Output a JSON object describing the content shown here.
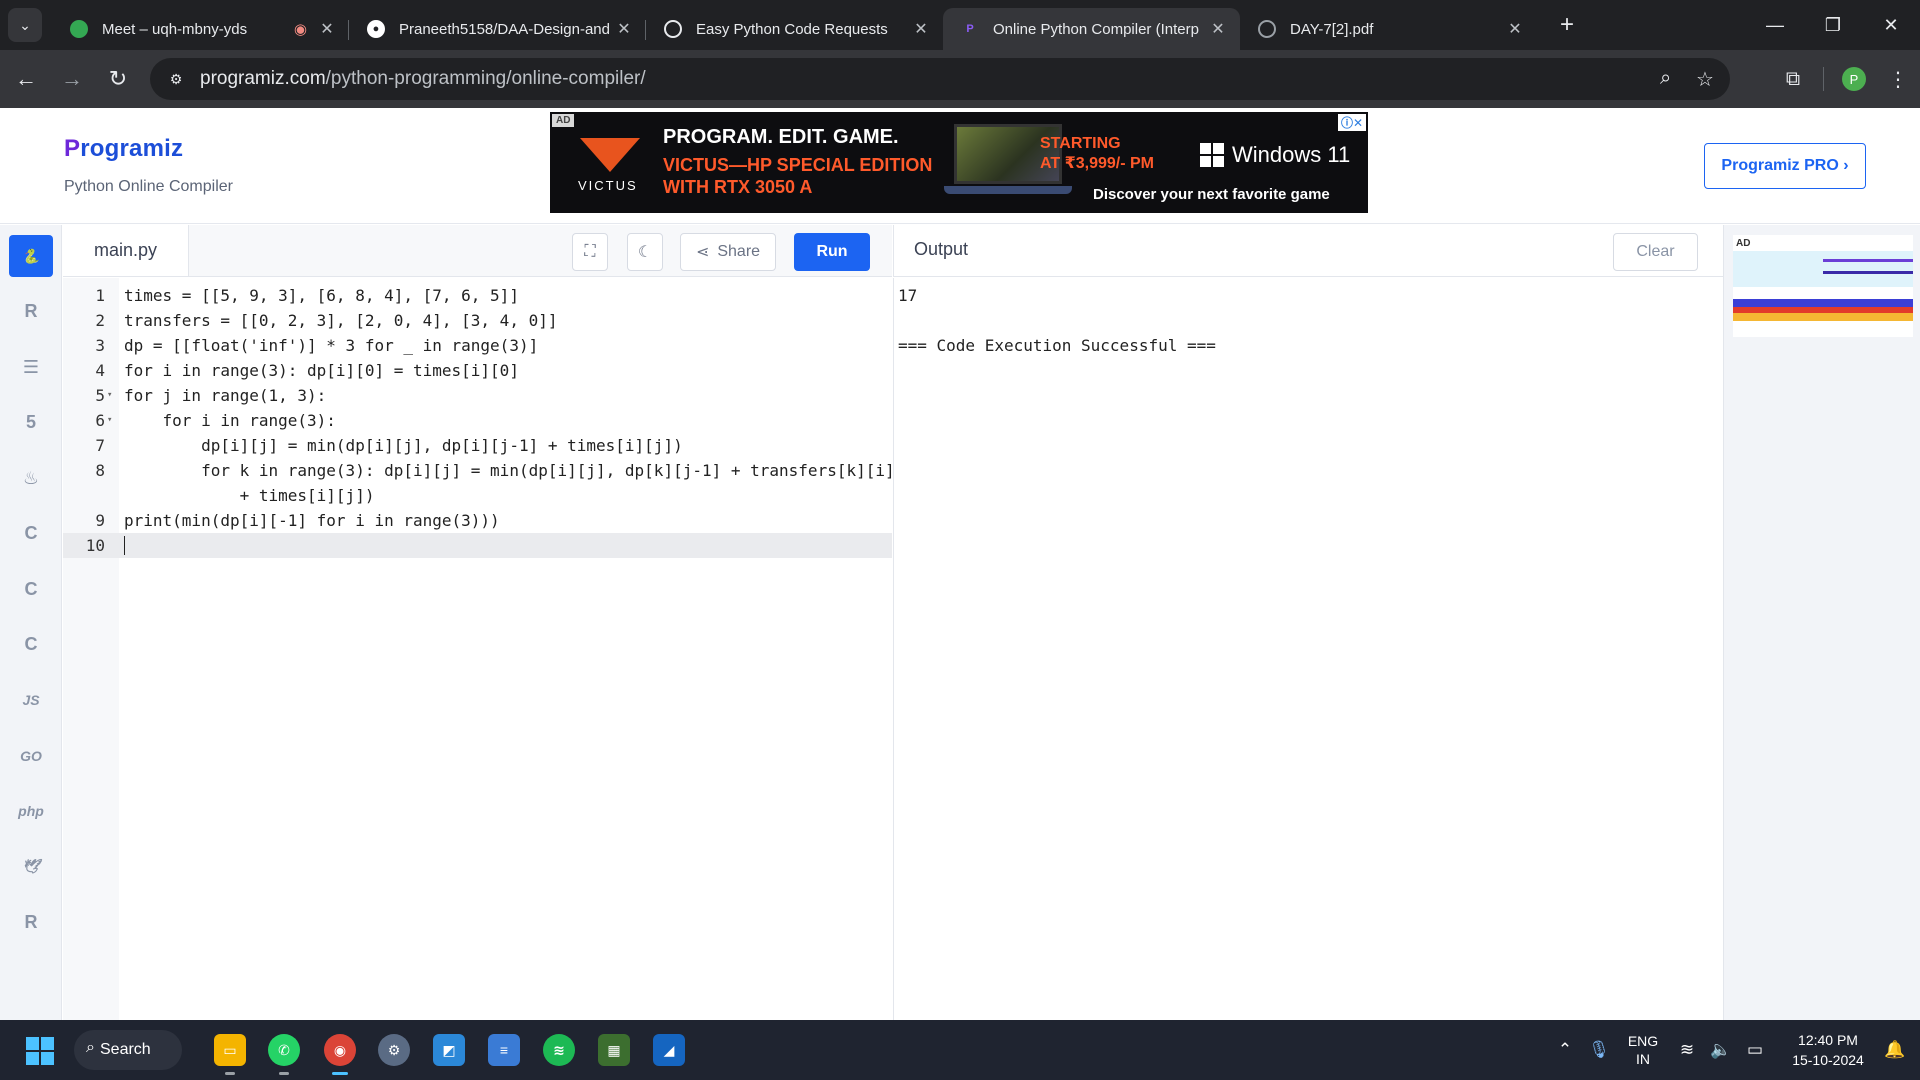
{
  "browser": {
    "tabs": [
      {
        "title": "Meet – uqh-mbny-yds",
        "favicon_color": "#34a853",
        "recording": true
      },
      {
        "title": "Praneeth5158/DAA-Design-and",
        "favicon_color": "#ffffff"
      },
      {
        "title": "Easy Python Code Requests",
        "favicon_color": "#e8eaed"
      },
      {
        "title": "Online Python Compiler (Interp",
        "favicon_color": "#6d28d9",
        "active": true
      },
      {
        "title": "DAY-7[2].pdf",
        "favicon_color": "#9aa0a6"
      }
    ],
    "url_domain": "programiz.com",
    "url_path": "/python-programming/online-compiler/",
    "profile_initial": "P"
  },
  "header": {
    "logo_first": "P",
    "logo_rest": "rogramiz",
    "subtitle": "Python Online Compiler",
    "pro_button": "Programiz PRO ›"
  },
  "ad": {
    "tag": "AD",
    "brand": "VICTUS",
    "headline": "PROGRAM. EDIT. GAME.",
    "subhead_1": "VICTUS—HP SPECIAL EDITION",
    "subhead_2": "WITH RTX 3050 A",
    "price_1": "STARTING",
    "price_2": "AT ₹3,999/- PM",
    "windows": "Windows 11",
    "cta": "Discover your next favorite game"
  },
  "languages": [
    {
      "name": "python-icon",
      "glyph": "🐍",
      "active": true
    },
    {
      "name": "r-icon",
      "glyph": "R"
    },
    {
      "name": "sql-icon",
      "glyph": "☰"
    },
    {
      "name": "html-icon",
      "glyph": "5"
    },
    {
      "name": "java-icon",
      "glyph": "♨"
    },
    {
      "name": "c-icon",
      "glyph": "C"
    },
    {
      "name": "cpp-icon",
      "glyph": "C"
    },
    {
      "name": "csharp-icon",
      "glyph": "C"
    },
    {
      "name": "js-icon",
      "glyph": "JS"
    },
    {
      "name": "go-icon",
      "glyph": "GO"
    },
    {
      "name": "php-icon",
      "glyph": "php"
    },
    {
      "name": "swift-icon",
      "glyph": "🕊"
    },
    {
      "name": "rust-icon",
      "glyph": "R"
    }
  ],
  "editor": {
    "filename": "main.py",
    "share_label": "Share",
    "run_label": "Run",
    "lines": [
      {
        "n": "1",
        "code": "times = [[5, 9, 3], [6, 8, 4], [7, 6, 5]]"
      },
      {
        "n": "2",
        "code": "transfers = [[0, 2, 3], [2, 0, 4], [3, 4, 0]]"
      },
      {
        "n": "3",
        "code": "dp = [[float('inf')] * 3 for _ in range(3)]"
      },
      {
        "n": "4",
        "code": "for i in range(3): dp[i][0] = times[i][0]"
      },
      {
        "n": "5",
        "code": "for j in range(1, 3):",
        "fold": true
      },
      {
        "n": "6",
        "code": "    for i in range(3):",
        "fold": true
      },
      {
        "n": "7",
        "code": "        dp[i][j] = min(dp[i][j], dp[i][j-1] + times[i][j])"
      },
      {
        "n": "8",
        "code": "        for k in range(3): dp[i][j] = min(dp[i][j], dp[k][j-1] + transfers[k][i]"
      },
      {
        "n": "",
        "code": "            + times[i][j])"
      },
      {
        "n": "9",
        "code": "print(min(dp[i][-1] for i in range(3)))"
      },
      {
        "n": "10",
        "code": "",
        "active": true
      }
    ]
  },
  "output": {
    "title": "Output",
    "clear_label": "Clear",
    "lines": [
      "17",
      "",
      "=== Code Execution Successful ==="
    ]
  },
  "rail_ad": {
    "tag": "AD"
  },
  "taskbar": {
    "search_label": "Search",
    "lang_line1": "ENG",
    "lang_line2": "IN",
    "time": "12:40 PM",
    "date": "15-10-2024"
  }
}
